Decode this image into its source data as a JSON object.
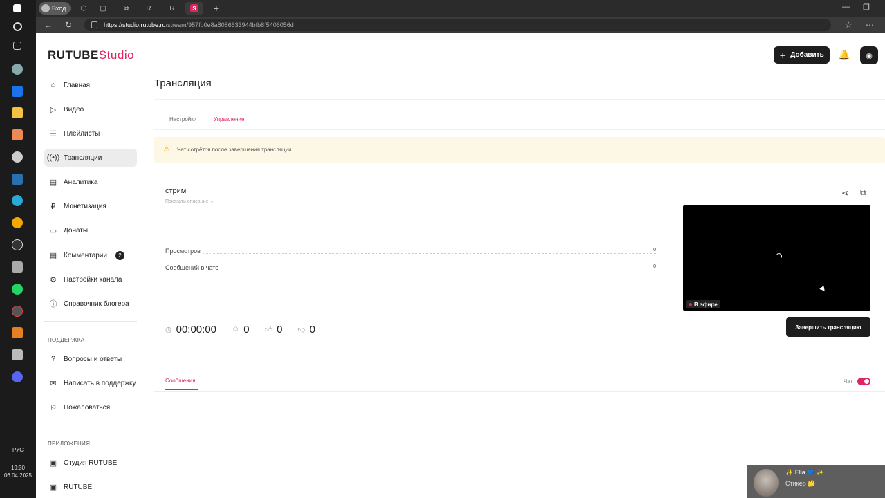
{
  "taskbar": {
    "icons": [
      "windows-icon",
      "search-icon",
      "task-view-icon",
      "steam-launcher-icon",
      "outlook-icon",
      "explorer-icon",
      "store-icon",
      "settings-icon",
      "steam-icon",
      "edge-icon",
      "chrome-icon",
      "obs-icon",
      "camera-icon",
      "whatsapp-icon",
      "recorder-icon",
      "browser-icon",
      "vpn-icon",
      "discord-icon"
    ],
    "lang": "РУС",
    "time": "19:30",
    "date": "06.04.2025"
  },
  "browser": {
    "profile_label": "Вход",
    "active_tab_favicon": "S",
    "url_host": "https://studio.rutube.ru",
    "url_path": "/stream/957fb0e8a8086633944bfb8f5406056d"
  },
  "app": {
    "logo_main": "RUTUBE",
    "logo_sub": "Studio",
    "add_button": "Добавить",
    "accent": "#e0245e"
  },
  "sidebar": {
    "items": [
      {
        "label": "Главная",
        "icon": "home-icon"
      },
      {
        "label": "Видео",
        "icon": "video-icon"
      },
      {
        "label": "Плейлисты",
        "icon": "playlist-icon"
      },
      {
        "label": "Трансляции",
        "icon": "broadcast-icon"
      },
      {
        "label": "Аналитика",
        "icon": "analytics-icon"
      },
      {
        "label": "Монетизация",
        "icon": "ruble-icon"
      },
      {
        "label": "Донаты",
        "icon": "donate-icon"
      },
      {
        "label": "Комментарии",
        "icon": "comment-icon",
        "badge": "2"
      },
      {
        "label": "Настройки канала",
        "icon": "gear-icon"
      },
      {
        "label": "Справочник блогера",
        "icon": "info-icon"
      }
    ],
    "support_title": "ПОДДЕРЖКА",
    "support_items": [
      {
        "label": "Вопросы и ответы"
      },
      {
        "label": "Написать в поддержку"
      },
      {
        "label": "Пожаловаться"
      }
    ],
    "apps_title": "ПРИЛОЖЕНИЯ",
    "apps_items": [
      {
        "label": "Студия RUTUBE"
      },
      {
        "label": "RUTUBE"
      }
    ]
  },
  "page": {
    "title": "Трансляция",
    "tabs": [
      "Настройки",
      "Управление"
    ],
    "notice": "Чат сотрётся после завершения трансляции"
  },
  "stream": {
    "name": "стрим",
    "show_description": "Показать описание",
    "stats": [
      {
        "label": "Просмотров",
        "value": "0"
      },
      {
        "label": "Сообщений в чате",
        "value": "0"
      }
    ],
    "duration": "00:00:00",
    "viewers": "0",
    "likes": "0",
    "dislikes": "0",
    "live_label": "В эфире",
    "end_button": "Завершить трансляцию"
  },
  "chat": {
    "tab": "Сообщения",
    "toggle_label": "Чат",
    "toggle_on": true
  },
  "overlay": {
    "name": "✨ Elia 💙 ✨",
    "sub": "Стикер 🤔"
  }
}
